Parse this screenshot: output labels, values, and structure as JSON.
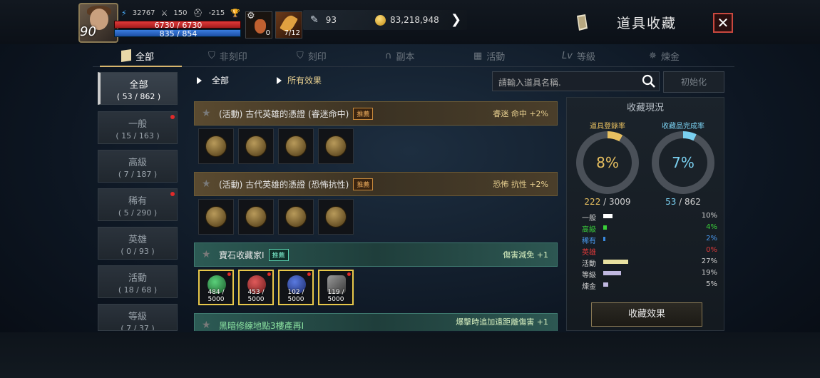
{
  "header": {
    "level": "90",
    "stats": {
      "power": "32767",
      "attack": "150",
      "defense": "-215",
      "dash": "-"
    },
    "hp": "6730 / 6730",
    "mp": "835 / 854",
    "potion_count": "0",
    "item_count": "7/12",
    "feather": "93",
    "gold": "83,218,948",
    "title": "道具收藏",
    "close_label": "✕"
  },
  "tabs": [
    {
      "label": "全部",
      "icon": "book-icon",
      "active": true
    },
    {
      "label": "非刻印",
      "icon": "shield-icon",
      "active": false
    },
    {
      "label": "刻印",
      "icon": "shield-icon",
      "active": false
    },
    {
      "label": "副本",
      "icon": "gate-icon",
      "active": false
    },
    {
      "label": "活動",
      "icon": "gift-icon",
      "active": false
    },
    {
      "label": "等級",
      "icon": "level-icon",
      "active": false
    },
    {
      "label": "煉金",
      "icon": "alchemy-icon",
      "active": false
    }
  ],
  "categories": [
    {
      "name": "全部",
      "count": "( 53 / 862 )",
      "active": true,
      "dot": false
    },
    {
      "name": "一般",
      "count": "( 15 / 163 )",
      "active": false,
      "dot": true
    },
    {
      "name": "高級",
      "count": "( 7 / 187 )",
      "active": false,
      "dot": false
    },
    {
      "name": "稀有",
      "count": "( 5 / 290 )",
      "active": false,
      "dot": true
    },
    {
      "name": "英雄",
      "count": "( 0 / 93 )",
      "active": false,
      "dot": false
    },
    {
      "name": "活動",
      "count": "( 18 / 68 )",
      "active": false,
      "dot": false
    },
    {
      "name": "等級",
      "count": "( 7 / 37 )",
      "active": false,
      "dot": false
    }
  ],
  "filters": {
    "category": "全部",
    "effect": "所有效果"
  },
  "search": {
    "placeholder": "請輸入道具名稱.",
    "reset_label": "初始化"
  },
  "collections": [
    {
      "name": "(活動) 古代英雄的憑證 (睿迷命中)",
      "badge": "推薦",
      "effect": "睿迷 命中 +2%",
      "style": "gold",
      "items": [
        {
          "type": "coin",
          "count": ""
        },
        {
          "type": "coin",
          "count": ""
        },
        {
          "type": "coin",
          "count": ""
        },
        {
          "type": "coin",
          "count": ""
        }
      ]
    },
    {
      "name": "(活動) 古代英雄的憑證 (恐怖抗性)",
      "badge": "推薦",
      "effect": "恐怖 抗性 +2%",
      "style": "gold",
      "items": [
        {
          "type": "coin",
          "count": ""
        },
        {
          "type": "coin",
          "count": ""
        },
        {
          "type": "coin",
          "count": ""
        },
        {
          "type": "coin",
          "count": ""
        }
      ]
    },
    {
      "name": "寶石收藏家I",
      "badge": "推薦",
      "effect": "傷害減免 +1",
      "style": "teal",
      "items": [
        {
          "type": "gem",
          "color": "#2f8a4a",
          "count": "484 / 5000"
        },
        {
          "type": "gem",
          "color": "#a82a2a",
          "count": "453 / 5000"
        },
        {
          "type": "gem",
          "color": "#2a4aa8",
          "count": "102 / 5000"
        },
        {
          "type": "gem",
          "color": "#6a6a6a",
          "count": "119 / 5000"
        }
      ]
    },
    {
      "name": "黑暗修練地點3樓產再I",
      "badge": "",
      "effect": "爆擊時追加遠距離傷害 +1",
      "style": "teal",
      "items": []
    }
  ],
  "status": {
    "title": "收藏現況",
    "reg_label": "道具登錄率",
    "reg_percent": "8%",
    "reg_value": 0.08,
    "reg_frac_a": "222",
    "reg_frac_b": "/ 3009",
    "comp_label": "收藏品完成率",
    "comp_percent": "7%",
    "comp_value": 0.07,
    "comp_frac_a": "53",
    "comp_frac_b": "/ 862",
    "grades": [
      {
        "name": "一般",
        "percent": "10%",
        "value": 10,
        "color": "#ffffff",
        "textcolor": "#d0d0d0"
      },
      {
        "name": "高級",
        "percent": "4%",
        "value": 4,
        "color": "#3ad03a",
        "textcolor": "#3ad03a"
      },
      {
        "name": "稀有",
        "percent": "2%",
        "value": 2,
        "color": "#3a8ae0",
        "textcolor": "#4a9af0"
      },
      {
        "name": "英雄",
        "percent": "0%",
        "value": 0,
        "color": "#e03a3a",
        "textcolor": "#e03a3a"
      },
      {
        "name": "活動",
        "percent": "27%",
        "value": 27,
        "color": "#e8e0a0",
        "textcolor": "#d0d0d0"
      },
      {
        "name": "等級",
        "percent": "19%",
        "value": 19,
        "color": "#c0b8e0",
        "textcolor": "#d0d0d0"
      },
      {
        "name": "煉金",
        "percent": "5%",
        "value": 5,
        "color": "#c0b8e0",
        "textcolor": "#d0d0d0"
      }
    ],
    "effect_button": "收藏效果"
  }
}
